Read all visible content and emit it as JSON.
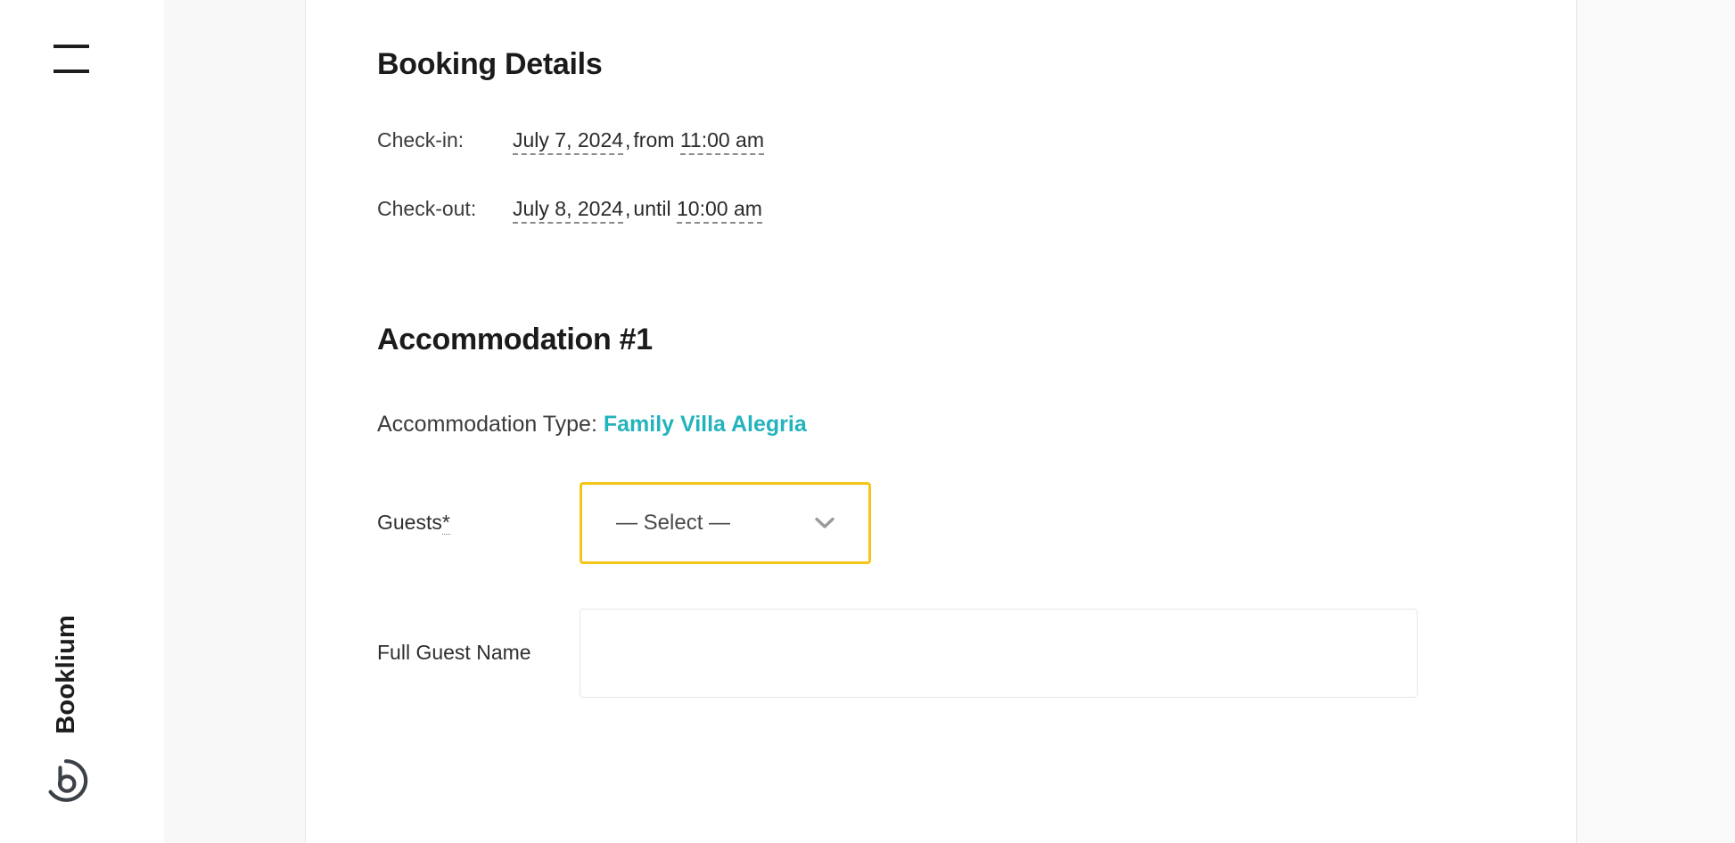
{
  "brand": {
    "name": "Booklium",
    "logo_icon": "booklium-b-circle-logo",
    "menu_icon": "hamburger-menu-icon"
  },
  "colors": {
    "accent_teal": "#23b3bd",
    "focus_yellow": "#f3c618",
    "text_dark": "#1b1b1b",
    "text_body": "#3b3b3b",
    "panel_grey": "#f8f8f8",
    "right_grey": "#fafafa"
  },
  "booking": {
    "heading": "Booking Details",
    "checkin": {
      "label": "Check-in:",
      "date": "July 7, 2024",
      "separator": ",",
      "preposition": "from",
      "time": "11:00 am"
    },
    "checkout": {
      "label": "Check-out:",
      "date": "July 8, 2024",
      "separator": ",",
      "preposition": "until",
      "time": "10:00 am"
    }
  },
  "accommodation": {
    "heading": "Accommodation #1",
    "type_label": "Accommodation Type:",
    "type_value": "Family Villa Alegria",
    "guests": {
      "label": "Guests",
      "required_marker": "*",
      "selected_option": "— Select —",
      "chevron_icon": "chevron-down-icon"
    },
    "guest_name": {
      "label": "Full Guest Name",
      "value": "",
      "placeholder": ""
    }
  }
}
